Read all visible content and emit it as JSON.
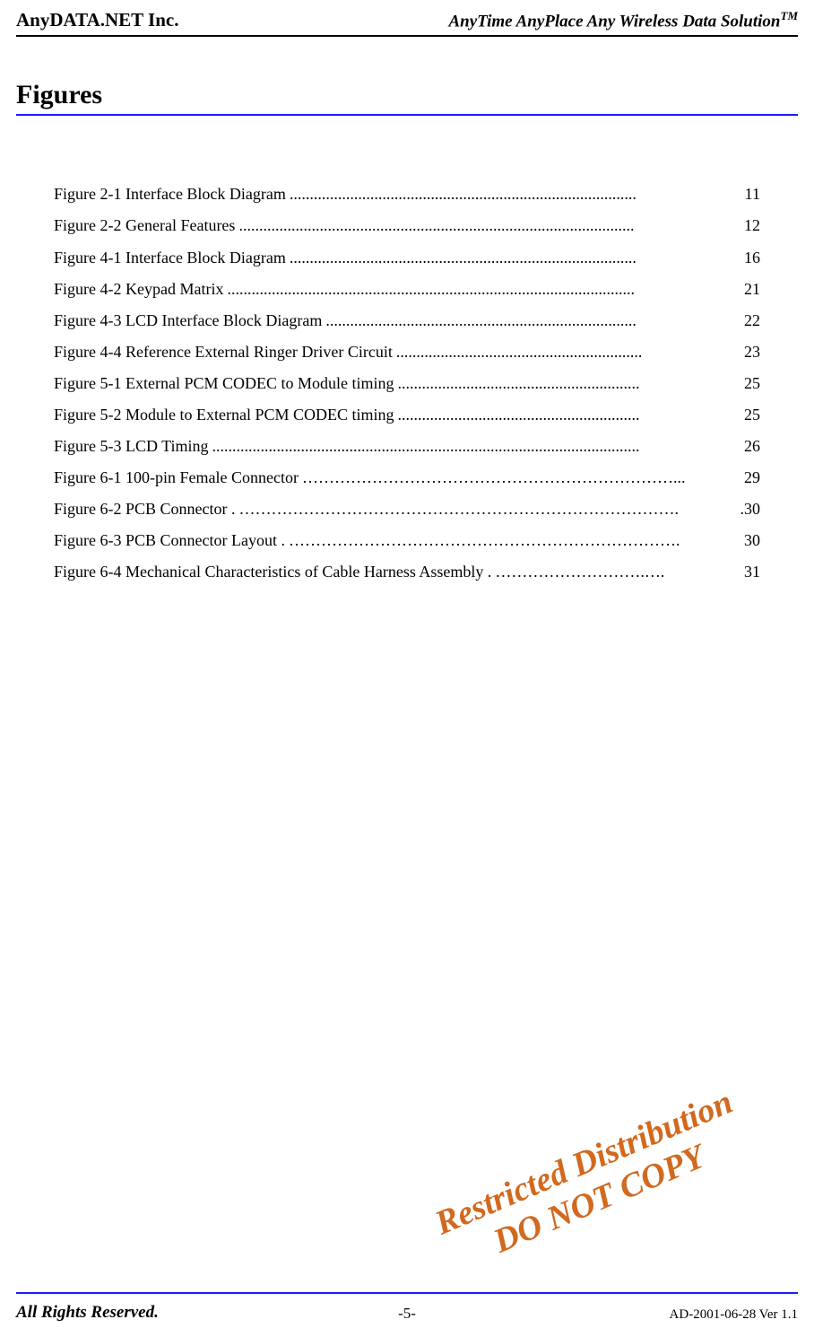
{
  "header": {
    "left": "AnyDATA.NET Inc.",
    "right_main": "AnyTime AnyPlace Any Wireless Data Solution",
    "right_sup": "TM"
  },
  "section_title": "Figures",
  "figures": [
    {
      "label": "Figure 2-1 Interface Block Diagram  ",
      "dots": "......................................................................................",
      "page": "  11"
    },
    {
      "label": "Figure 2-2 General Features  ",
      "dots": "..................................................................................................",
      "page": "  12"
    },
    {
      "label": "Figure 4-1 Interface Block Diagram  ",
      "dots": "......................................................................................",
      "page": "  16"
    },
    {
      "label": "Figure 4-2 Keypad Matrix  ",
      "dots": ".....................................................................................................",
      "page": "  21"
    },
    {
      "label": "Figure 4-3 LCD Interface Block Diagram  ",
      "dots": ".............................................................................",
      "page": "  22"
    },
    {
      "label": "Figure 4-4 Reference External Ringer Driver Circuit  ",
      "dots": ".............................................................",
      "page": "  23"
    },
    {
      "label": "Figure 5-1 External PCM CODEC to Module timing  ",
      "dots": "............................................................",
      "page": "  25"
    },
    {
      "label": "Figure 5-2 Module to External PCM CODEC timing  ",
      "dots": "............................................................",
      "page": "  25"
    },
    {
      "label": "Figure 5-3 LCD Timing  ",
      "dots": "..........................................................................................................",
      "page": "  26"
    },
    {
      "label": "Figure 6-1 100-pin Female Connector ",
      "dots": "……………………………………………………………...",
      "page": " 29"
    },
    {
      "label": "Figure 6-2 PCB Connector .",
      "dots": "……………………………………………………………………….",
      "page": ".30"
    },
    {
      "label": "Figure 6-3 PCB Connector Layout .",
      "dots": "……………………………………………………………….",
      "page": " 30"
    },
    {
      "label": "Figure 6-4 Mechanical Characteristics of Cable Harness Assembly .",
      "dots": "……………………….….",
      "page": " 31"
    }
  ],
  "watermark": {
    "line1": "Restricted Distribution",
    "line2": "DO NOT COPY"
  },
  "footer": {
    "left": "All Rights Reserved.",
    "center": "-5-",
    "right": "AD-2001-06-28 Ver 1.1"
  }
}
